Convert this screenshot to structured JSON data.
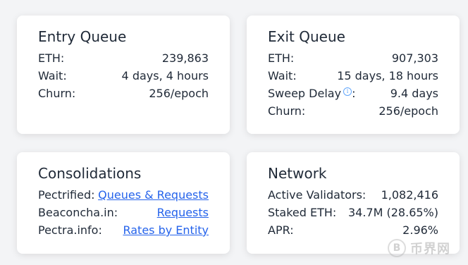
{
  "entry_queue": {
    "title": "Entry Queue",
    "rows": [
      {
        "label": "ETH:",
        "value": "239,863"
      },
      {
        "label": "Wait:",
        "value": "4 days, 4 hours"
      },
      {
        "label": "Churn:",
        "value": "256/epoch"
      }
    ]
  },
  "exit_queue": {
    "title": "Exit Queue",
    "rows": [
      {
        "label": "ETH:",
        "value": "907,303"
      },
      {
        "label": "Wait:",
        "value": "15 days, 18 hours"
      },
      {
        "label": "Sweep Delay",
        "label_suffix": ":",
        "value": "9.4 days"
      },
      {
        "label": "Churn:",
        "value": "256/epoch"
      }
    ]
  },
  "consolidations": {
    "title": "Consolidations",
    "rows": [
      {
        "label": "Pectrified:",
        "link": "Queues & Requests"
      },
      {
        "label": "Beaconcha.in:",
        "link": "Requests"
      },
      {
        "label": "Pectra.info:",
        "link": "Rates by Entity"
      }
    ]
  },
  "network": {
    "title": "Network",
    "rows": [
      {
        "label": "Active Validators:",
        "value": "1,082,416"
      },
      {
        "label": "Staked ETH:",
        "value": "34.7M (28.65%)"
      },
      {
        "label": "APR:",
        "value": "2.96%"
      }
    ]
  },
  "icons": {
    "info": "i",
    "watermark_glyph": "B"
  },
  "watermark": {
    "text": "币界网"
  }
}
